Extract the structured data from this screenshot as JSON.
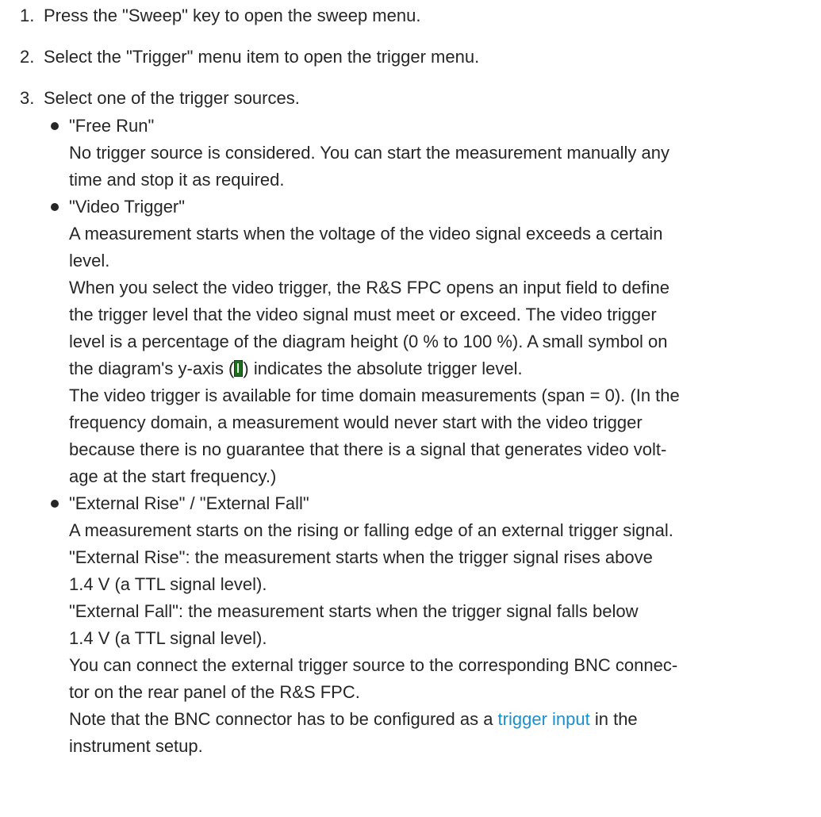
{
  "steps": [
    {
      "number": "1.",
      "text": "Press the \"Sweep\" key to open the sweep menu."
    },
    {
      "number": "2.",
      "text": "Select the \"Trigger\" menu item to open the trigger menu."
    },
    {
      "number": "3.",
      "text": "Select one of the trigger sources."
    }
  ],
  "free_run": {
    "title": "\"Free Run\"",
    "lines": [
      "No trigger source is considered. You can start the measurement manually any",
      "time and stop it as required."
    ]
  },
  "video_trigger": {
    "title": "\"Video Trigger\"",
    "lines": [
      "A measurement starts when the voltage of the video signal exceeds a certain",
      "level.",
      "When you select the video trigger, the R&S FPC opens an input field to define",
      "the trigger level that the video signal must meet or exceed. The video trigger",
      "level is a percentage of the diagram height (0 % to 100 %). A small symbol on"
    ],
    "symbol_line_before": "the diagram's y-axis (",
    "symbol_line_after": ") indicates the absolute trigger level.",
    "lines_after": [
      "The video trigger is available for time domain measurements (span = 0). (In the",
      "frequency domain, a measurement would never start with the video trigger",
      "because there is no guarantee that there is a signal that generates video volt-",
      "age at the start frequency.)"
    ]
  },
  "external": {
    "title": "\"External Rise\" / \"External Fall\"",
    "lines": [
      "A measurement starts on the rising or falling edge of an external trigger signal.",
      "\"External Rise\": the measurement starts when the trigger signal rises above",
      "1.4 V (a TTL signal level).",
      "\"External Fall\": the measurement starts when the trigger signal falls below",
      "1.4 V (a TTL signal level).",
      "You can connect the external trigger source to the corresponding BNC connec-",
      "tor on the rear panel of the R&S FPC."
    ],
    "note_before": "Note that the BNC connector has to be configured as a ",
    "note_link": "trigger input",
    "note_after": " in the",
    "last_line": "instrument setup."
  }
}
